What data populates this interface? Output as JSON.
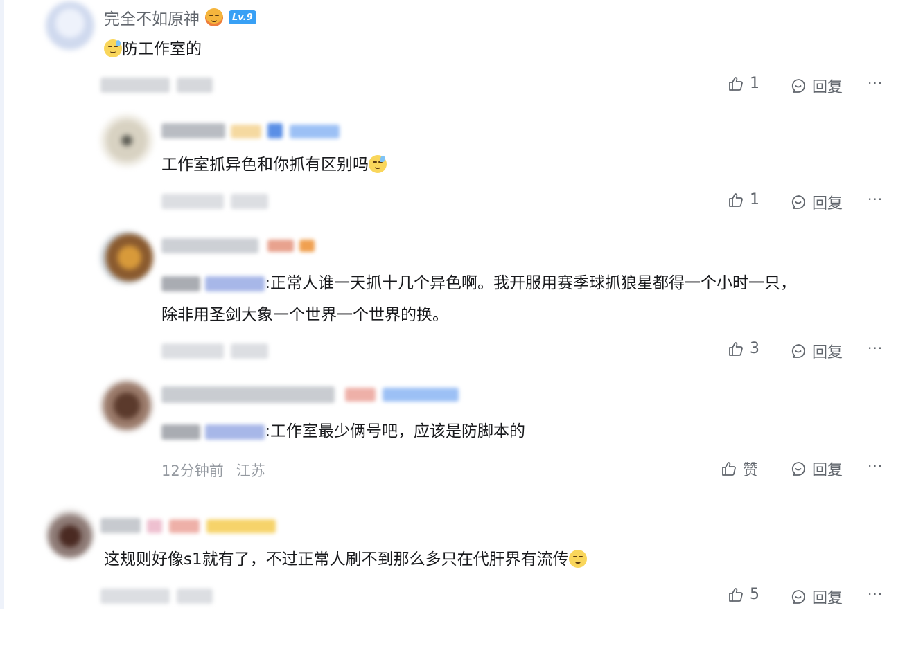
{
  "comments": [
    {
      "username": "完全不如原神",
      "level_badge": "Lv.9",
      "text": "防工作室的",
      "likes": "1",
      "reply_label": "回复",
      "more_label": "···"
    },
    {
      "text": "工作室抓异色和你抓有区别吗",
      "likes": "1",
      "reply_label": "回复",
      "more_label": "···"
    },
    {
      "text_line1": ":正常人谁一天抓十几个异色啊。我开服用赛季球抓狼星都得一个小时一只，",
      "text_line2": "除非用圣剑大象一个世界一个世界的换。",
      "likes": "3",
      "reply_label": "回复",
      "more_label": "···"
    },
    {
      "text": ":工作室最少俩号吧，应该是防脚本的",
      "time": "12分钟前",
      "location": "江苏",
      "like_label": "赞",
      "reply_label": "回复",
      "more_label": "···"
    },
    {
      "text": "这规则好像s1就有了，不过正常人刷不到那么多只在代肝界有流传",
      "likes": "5",
      "reply_label": "回复",
      "more_label": "···"
    }
  ],
  "icons": {
    "like": "thumbs-up-icon",
    "reply": "reply-bubble-icon",
    "more": "more-dots-icon"
  },
  "colors": {
    "level_badge": "#38a0f5",
    "meta_text": "#9499a0",
    "action_text": "#61666d"
  }
}
